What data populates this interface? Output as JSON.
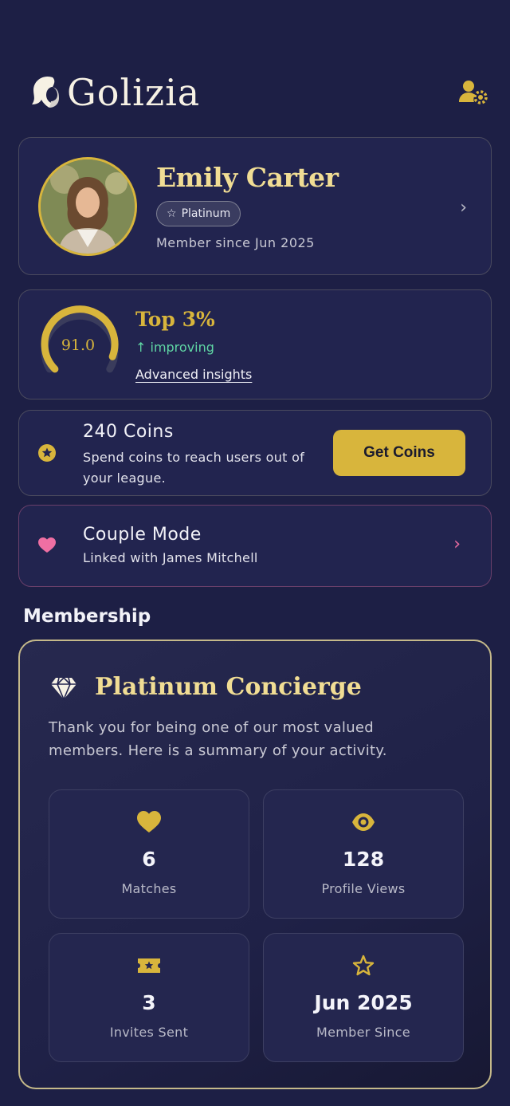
{
  "app": {
    "name": "Golizia",
    "accent_color": "#d8b53c",
    "settings_icon": "user-settings-icon"
  },
  "profile": {
    "name": "Emily Carter",
    "tier": "Platinum",
    "tier_icon": "star-outline-icon",
    "member_since": "Member since Jun 2025"
  },
  "score": {
    "value": "91.0",
    "gauge_fraction": 0.91,
    "rank": "Top 3%",
    "trend": "↑ improving",
    "insights_link": "Advanced insights"
  },
  "coins": {
    "title": "240 Coins",
    "description": "Spend coins to reach users out of your league.",
    "button": "Get Coins"
  },
  "couple": {
    "title": "Couple Mode",
    "subtitle": "Linked with James Mitchell"
  },
  "membership": {
    "section_title": "Membership",
    "title": "Platinum Concierge",
    "description": "Thank you for being one of our most valued members. Here is a summary of your activity.",
    "stats": [
      {
        "icon": "heart-icon",
        "value": "6",
        "label": "Matches"
      },
      {
        "icon": "eye-icon",
        "value": "128",
        "label": "Profile Views"
      },
      {
        "icon": "ticket-icon",
        "value": "3",
        "label": "Invites Sent"
      },
      {
        "icon": "star-outline-icon",
        "value": "Jun 2025",
        "label": "Member Since"
      }
    ]
  }
}
